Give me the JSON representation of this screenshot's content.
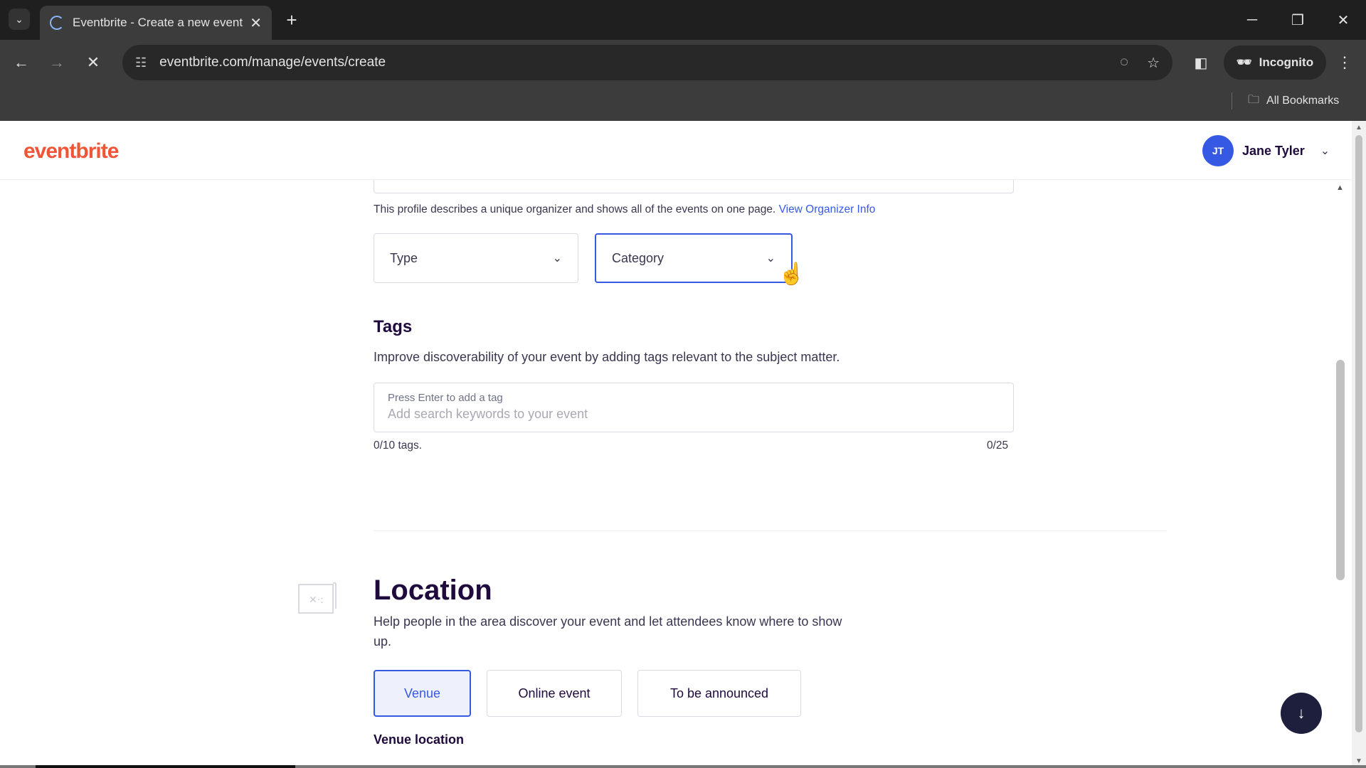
{
  "browser": {
    "tab_title": "Eventbrite - Create a new event",
    "url": "eventbrite.com/manage/events/create",
    "incognito_label": "Incognito",
    "bookmarks_label": "All Bookmarks"
  },
  "header": {
    "logo": "eventbrite",
    "user_initials": "JT",
    "user_name": "Jane Tyler"
  },
  "organizer": {
    "description": "This profile describes a unique organizer and shows all of the events on one page.",
    "link_text": "View Organizer Info"
  },
  "selects": {
    "type_label": "Type",
    "category_label": "Category"
  },
  "tags": {
    "title": "Tags",
    "description": "Improve discoverability of your event by adding tags relevant to the subject matter.",
    "input_label": "Press Enter to add a tag",
    "placeholder": "Add search keywords to your event",
    "tag_count": "0/10 tags.",
    "char_count": "0/25"
  },
  "location": {
    "title": "Location",
    "description": "Help people in the area discover your event and let attendees know where to show up.",
    "options": [
      "Venue",
      "Online event",
      "To be announced"
    ],
    "selected": "Venue",
    "venue_location_label": "Venue location"
  },
  "colors": {
    "brand": "#f05537",
    "accent": "#3659e3",
    "heading": "#1e0a3c"
  }
}
